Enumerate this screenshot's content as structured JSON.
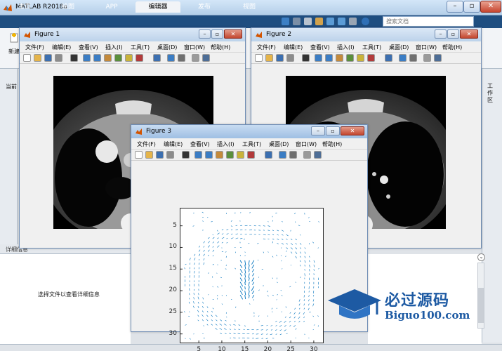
{
  "window": {
    "title": "MATLAB R2018a"
  },
  "ribbon": {
    "tabs": [
      "主页",
      "绘图",
      "APP",
      "编辑器",
      "发布",
      "视图"
    ],
    "active_tab": "编辑器",
    "new_label": "新建"
  },
  "search": {
    "placeholder": "搜索文档"
  },
  "panels": {
    "current_folder_label": "当前",
    "workspace_label": "工作区",
    "details_label": "详细信息",
    "details_message": "选择文件以查看详细信息"
  },
  "figure_menu": [
    "文件(F)",
    "编辑(E)",
    "查看(V)",
    "插入(I)",
    "工具(T)",
    "桌面(D)",
    "窗口(W)",
    "帮助(H)"
  ],
  "figures": [
    {
      "title": "Figure 1"
    },
    {
      "title": "Figure 2"
    },
    {
      "title": "Figure 3"
    }
  ],
  "chart_data": {
    "type": "quiver",
    "xticks": [
      5,
      10,
      15,
      20,
      25,
      30
    ],
    "yticks": [
      5,
      10,
      15,
      20,
      25,
      30
    ],
    "xlim": [
      1,
      32
    ],
    "ylim": [
      1,
      32
    ],
    "y_reversed": true,
    "grid": false,
    "arrow_color": "#0072bd"
  },
  "watermark": {
    "cn": "必过源码",
    "en": "Biguo100.com"
  },
  "colors": {
    "ribbon_bg": "#1f4e80",
    "accent": "#1d5aa3"
  }
}
